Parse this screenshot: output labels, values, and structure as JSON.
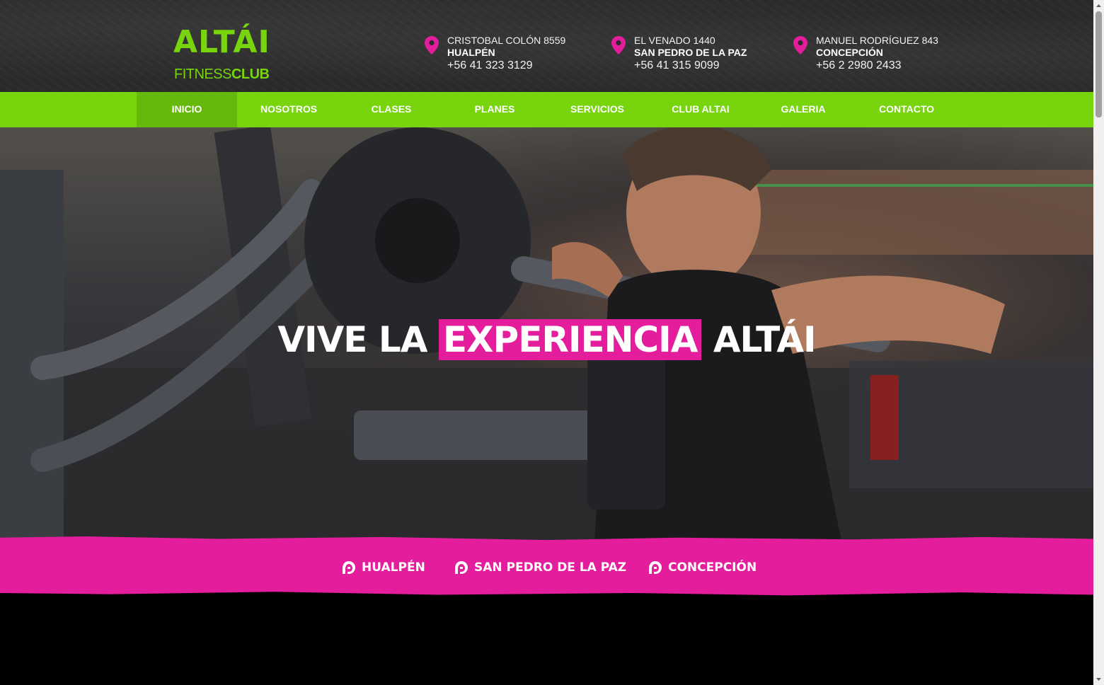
{
  "logo": {
    "top": "ALTÁI",
    "bottom_regular": "FITNESS",
    "bottom_bold": "CLUB"
  },
  "locations": [
    {
      "street": "CRISTOBAL COLÓN 8559",
      "city": "HUALPÉN",
      "phone": "+56 41 323 3129"
    },
    {
      "street": "EL VENADO 1440",
      "city": "SAN PEDRO DE LA PAZ",
      "phone": "+56 41 315 9099"
    },
    {
      "street": "MANUEL RODRÍGUEZ 843",
      "city": "CONCEPCIÓN",
      "phone": "+56 2 2980 2433"
    }
  ],
  "nav": {
    "items": [
      "INICIO",
      "NOSOTROS",
      "CLASES",
      "PLANES",
      "SERVICIOS",
      "CLUB ALTAI",
      "GALERIA",
      "CONTACTO"
    ],
    "active": "INICIO"
  },
  "hero": {
    "title_pre": "VIVE LA ",
    "title_highlight": "EXPERIENCIA",
    "title_post": " ALTÁI"
  },
  "branches": [
    "HUALPÉN",
    "SAN PEDRO DE LA PAZ",
    "CONCEPCIÓN"
  ],
  "colors": {
    "brand_green": "#77d40d",
    "brand_pink": "#e41d9d",
    "header_bg": "#2a2a2a"
  },
  "icons": {
    "location": "map-pin-icon",
    "branch": "altai-logo-mark-icon"
  }
}
